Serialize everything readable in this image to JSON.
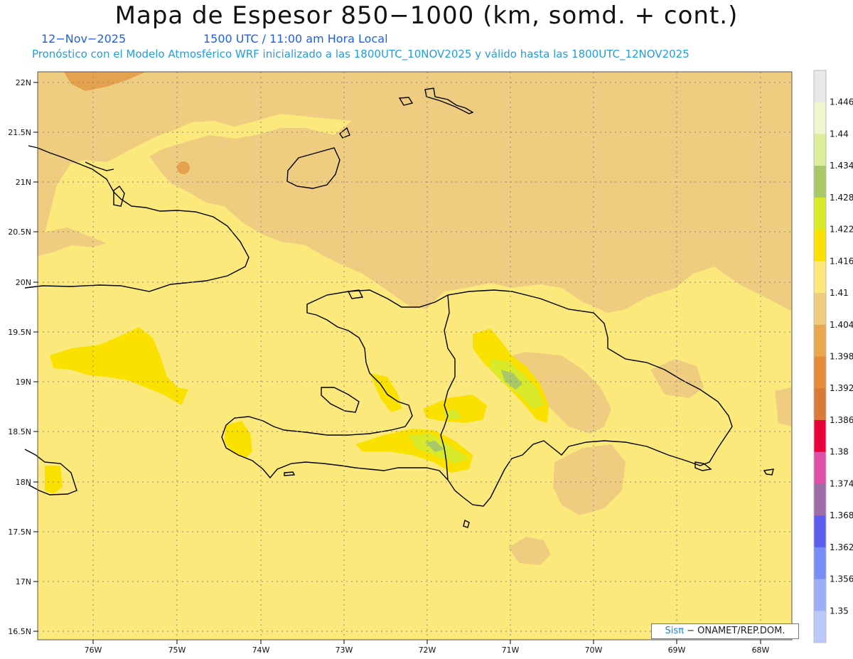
{
  "header": {
    "title": "Mapa de Espesor 850−1000 (km, somd. + cont.)",
    "date": "12−Nov−2025",
    "time": "1500 UTC / 11:00 am Hora Local",
    "forecast": "Pronóstico con el Modelo Atmosférico WRF inicializado a las 1800UTC_10NOV2025 y válido hasta las  1800UTC_12NOV2025"
  },
  "map": {
    "lat_labels": [
      "22N",
      "21.5N",
      "21N",
      "20.5N",
      "20N",
      "19.5N",
      "19N",
      "18.5N",
      "18N",
      "17.5N",
      "17N",
      "16.5N"
    ],
    "lon_labels": [
      "76W",
      "75W",
      "74W",
      "73W",
      "72W",
      "71W",
      "70W",
      "69W",
      "68W"
    ],
    "field_colors": {
      "below_1404": "#efcd80",
      "range_1404_1410": "#fce97b",
      "range_1410_1416": "#fae100",
      "range_1416_1422": "#d8ea2a",
      "range_1422_1428": "#a8c86a",
      "low_cell": "#e4a14e",
      "coast": "#000000"
    }
  },
  "colorbar": {
    "labels": [
      "1.446",
      "1.44",
      "1.434",
      "1.428",
      "1.422",
      "1.416",
      "1.41",
      "1.404",
      "1.398",
      "1.392",
      "1.386",
      "1.38",
      "1.374",
      "1.368",
      "1.362",
      "1.356",
      "1.35"
    ],
    "colors": [
      "#e8e8e8",
      "#eef5cf",
      "#dbee9c",
      "#a8c86a",
      "#d8ea2a",
      "#fae100",
      "#fce97b",
      "#efcd80",
      "#e8a850",
      "#e58c3c",
      "#d97a38",
      "#e8003a",
      "#e050a8",
      "#9b6eaa",
      "#5a5ff0",
      "#7a8cf5",
      "#9aaef8",
      "#bcc8fa"
    ]
  },
  "credit": {
    "logo": "Sisπ",
    "text": " − ONAMET/REP.DOM."
  }
}
